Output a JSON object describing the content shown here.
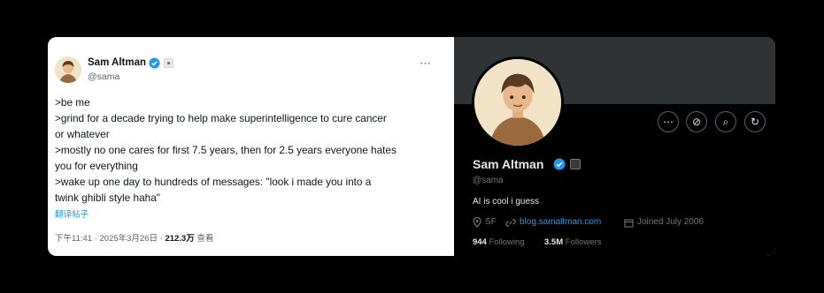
{
  "tweet": {
    "author_name": "Sam Altman",
    "handle": "@sama",
    "more_icon": "⋯",
    "lines": [
      ">be me",
      ">grind for a decade trying to help make superintelligence to cure cancer",
      "or whatever",
      ">mostly no one cares for first 7.5 years, then for 2.5 years everyone hates",
      "you for everything",
      ">wake up one day to hundreds of messages: \"look i made you into a",
      "twink ghibli style haha\""
    ],
    "translate_label": "翻译帖子",
    "timestamp": "下午11:41 · 2025年3月26日 · ",
    "views_count": "212.3万",
    "views_label": " 查看"
  },
  "profile": {
    "name": "Sam Altman",
    "handle": "@sama",
    "bio": "AI is cool i guess",
    "location": "SF",
    "website": "blog.samaltman.com",
    "joined": "Joined July 2006",
    "following_count": "944",
    "following_label": " Following",
    "followers_count": "3.5M",
    "followers_label": " Followers",
    "buttons": [
      {
        "name": "more-button",
        "glyph": "⋯"
      },
      {
        "name": "grok-button",
        "glyph": "⊘"
      },
      {
        "name": "search-button",
        "glyph": "⌕"
      },
      {
        "name": "notify-button",
        "glyph": "↻"
      }
    ]
  },
  "colors": {
    "verified": "#1d9bf0",
    "link": "#1d9bf0",
    "profile_bg": "#000000",
    "banner": "#2f3336"
  },
  "icons": {
    "verified": "verified-badge-icon",
    "location": "location-pin-icon",
    "link": "link-icon",
    "calendar": "calendar-icon"
  }
}
